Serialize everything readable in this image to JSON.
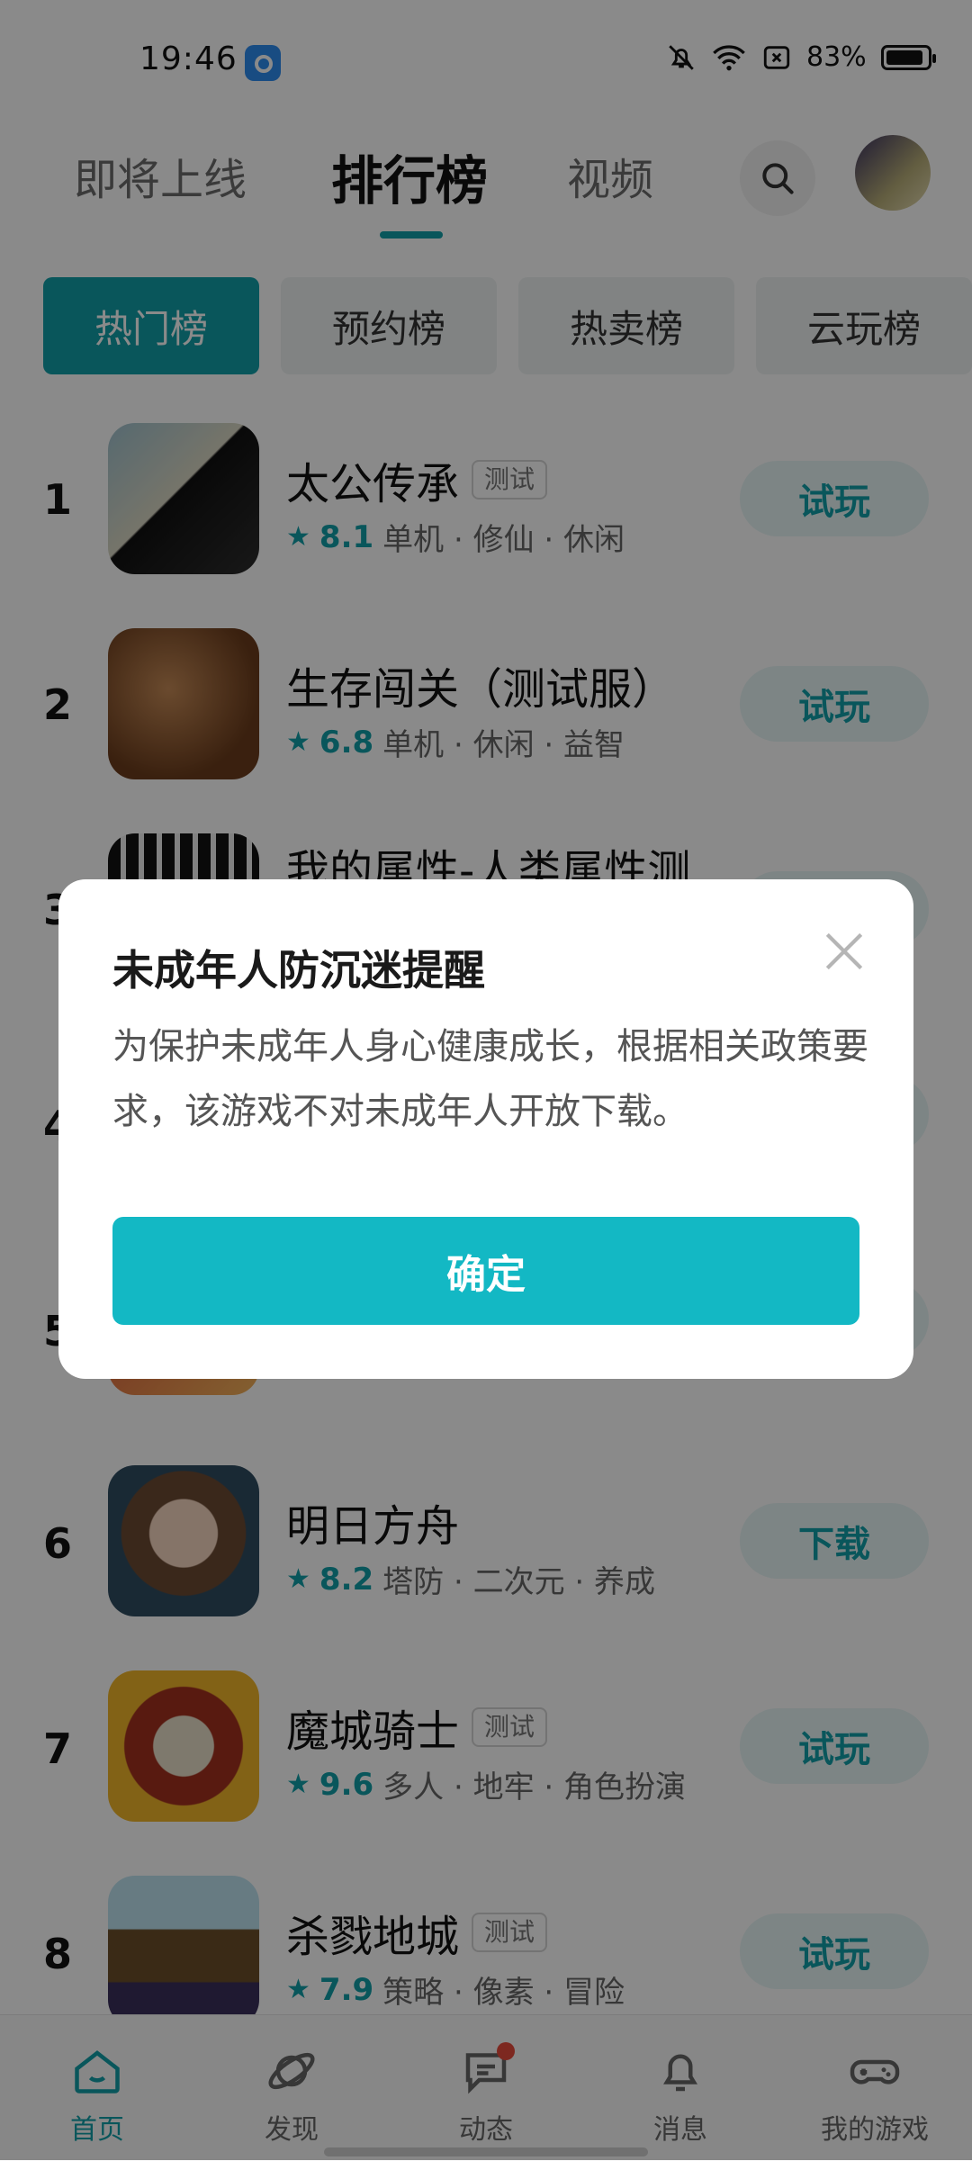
{
  "status_bar": {
    "time": "19:46",
    "battery": "83%"
  },
  "header": {
    "tabs": [
      {
        "label": "即将上线"
      },
      {
        "label": "排行榜"
      },
      {
        "label": "视频"
      }
    ]
  },
  "chips": [
    {
      "label": "热门榜"
    },
    {
      "label": "预约榜"
    },
    {
      "label": "热卖榜"
    },
    {
      "label": "云玩榜"
    }
  ],
  "games": [
    {
      "rank": "1",
      "title": "太公传承",
      "badge": "测试",
      "score": "8.1",
      "tags": "单机 · 修仙 · 休闲",
      "action": "试玩"
    },
    {
      "rank": "2",
      "title": "生存闯关（测试服）",
      "badge": "",
      "score": "6.8",
      "tags": "单机 · 休闲 · 益智",
      "action": "试玩"
    },
    {
      "rank": "3",
      "title": "我的属性-人类属性测",
      "badge": "",
      "score": "",
      "tags": "",
      "action": ""
    },
    {
      "rank": "4",
      "title": "",
      "badge": "",
      "score": "",
      "tags": "",
      "action": ""
    },
    {
      "rank": "5",
      "title": "",
      "badge": "",
      "score": "",
      "tags": "",
      "action": ""
    },
    {
      "rank": "6",
      "title": "明日方舟",
      "badge": "",
      "score": "8.2",
      "tags": "塔防 · 二次元 · 养成",
      "action": "下载"
    },
    {
      "rank": "7",
      "title": "魔城骑士",
      "badge": "测试",
      "score": "9.6",
      "tags": "多人 · 地牢 · 角色扮演",
      "action": "试玩"
    },
    {
      "rank": "8",
      "title": "杀戮地城",
      "badge": "测试",
      "score": "7.9",
      "tags": "策略 · 像素 · 冒险",
      "action": "试玩"
    }
  ],
  "dialog": {
    "title": "未成年人防沉迷提醒",
    "body": "为保护未成年人身心健康成长，根据相关政策要求，该游戏不对未成年人开放下载。",
    "confirm": "确定"
  },
  "bottom_nav": [
    {
      "label": "首页",
      "icon": "home-icon"
    },
    {
      "label": "发现",
      "icon": "planet-icon"
    },
    {
      "label": "动态",
      "icon": "chat-icon"
    },
    {
      "label": "消息",
      "icon": "bell-icon"
    },
    {
      "label": "我的游戏",
      "icon": "gamepad-icon"
    }
  ],
  "colors": {
    "accent": "#119fa8",
    "dialog_button": "#13b8c4"
  }
}
